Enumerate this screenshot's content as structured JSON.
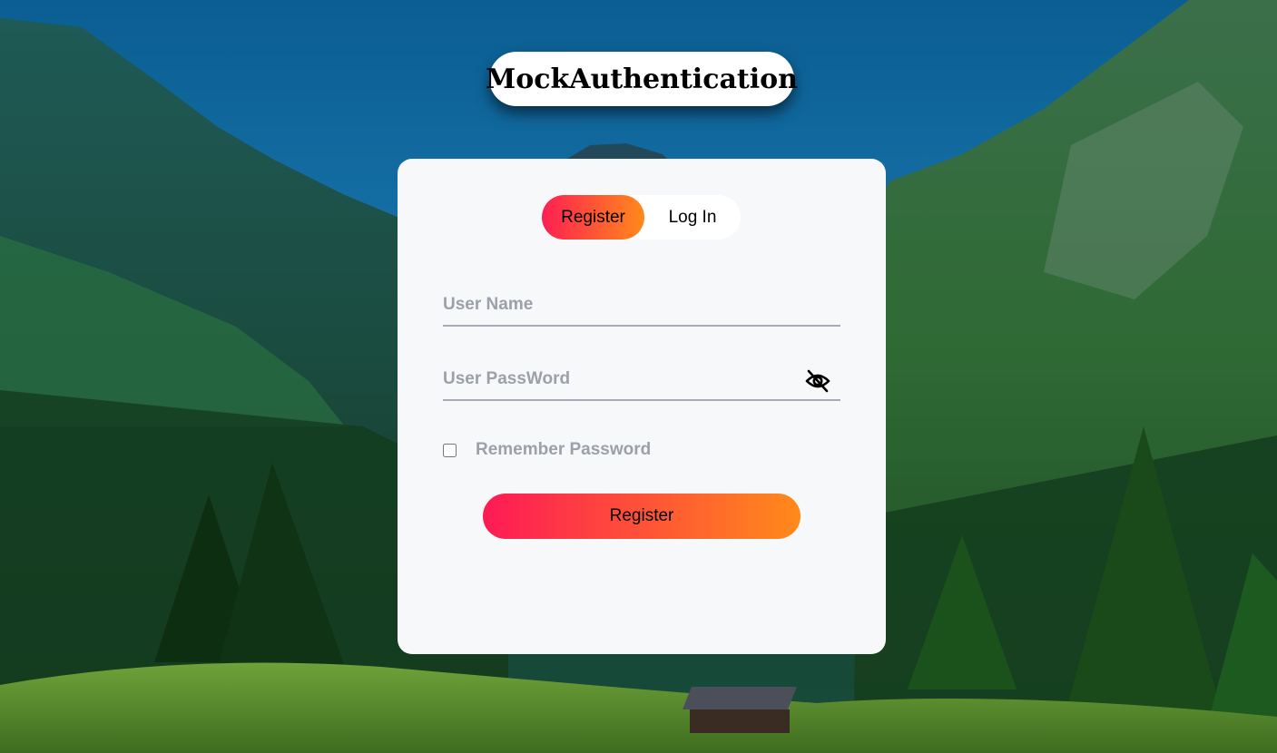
{
  "app": {
    "title": "MockAuthentication"
  },
  "tabs": [
    {
      "label": "Register",
      "active": true
    },
    {
      "label": "Log In",
      "active": false
    }
  ],
  "form": {
    "username": {
      "placeholder": "User Name",
      "value": ""
    },
    "password": {
      "placeholder": "User PassWord",
      "value": ""
    },
    "remember": {
      "label": "Remember Password",
      "checked": false
    },
    "submit_label": "Register"
  },
  "icons": {
    "password_toggle": "eye-off-icon"
  },
  "colors": {
    "gradient_start": "#fe1f52",
    "gradient_end": "#ff8a1a",
    "card_background": "#f7f8fa"
  }
}
